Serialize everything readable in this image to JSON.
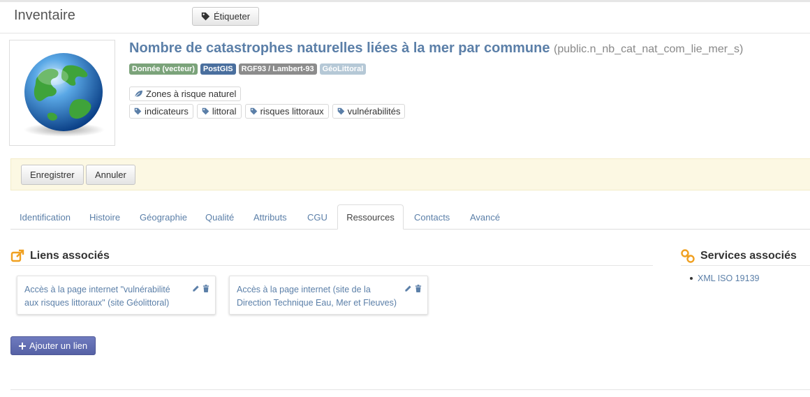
{
  "header": {
    "app_title": "Inventaire",
    "tag_button_label": "Étiqueter"
  },
  "dataset": {
    "title": "Nombre de catastrophes naturelles liées à la mer par commune",
    "table_name": "(public.n_nb_cat_nat_com_lie_mer_s)",
    "badges": [
      {
        "label": "Donnée (vecteur)",
        "color": "#7ba37a"
      },
      {
        "label": "PostGIS",
        "color": "#4a6f9e"
      },
      {
        "label": "RGF93 / Lambert-93",
        "color": "#8c8c8c"
      },
      {
        "label": "GéoLittoral",
        "color": "#b5c8d6"
      }
    ],
    "category": "Zones à risque naturel",
    "keywords": [
      "indicateurs",
      "littoral",
      "risques littoraux",
      "vulnérabilités"
    ]
  },
  "form_actions": {
    "save_label": "Enregistrer",
    "cancel_label": "Annuler"
  },
  "tabs": [
    {
      "label": "Identification",
      "active": false
    },
    {
      "label": "Histoire",
      "active": false
    },
    {
      "label": "Géographie",
      "active": false
    },
    {
      "label": "Qualité",
      "active": false
    },
    {
      "label": "Attributs",
      "active": false
    },
    {
      "label": "CGU",
      "active": false
    },
    {
      "label": "Ressources",
      "active": true
    },
    {
      "label": "Contacts",
      "active": false
    },
    {
      "label": "Avancé",
      "active": false
    }
  ],
  "links_section": {
    "title": "Liens associés",
    "links": [
      {
        "line1": "Accès à la page internet \"vulnérabilité",
        "line2": "aux risques littoraux\" (site Géolittoral)"
      },
      {
        "line1": "Accès à la page internet (site de la",
        "line2": "Direction Technique Eau, Mer et Fleuves)"
      }
    ],
    "add_link_label": "Ajouter un lien"
  },
  "services_section": {
    "title": "Services associés",
    "items": [
      "XML ISO 19139"
    ]
  },
  "colors": {
    "link": "#5b7fa8",
    "accent_orange": "#f0a020",
    "form_actions_bg": "#fcf8e3"
  }
}
